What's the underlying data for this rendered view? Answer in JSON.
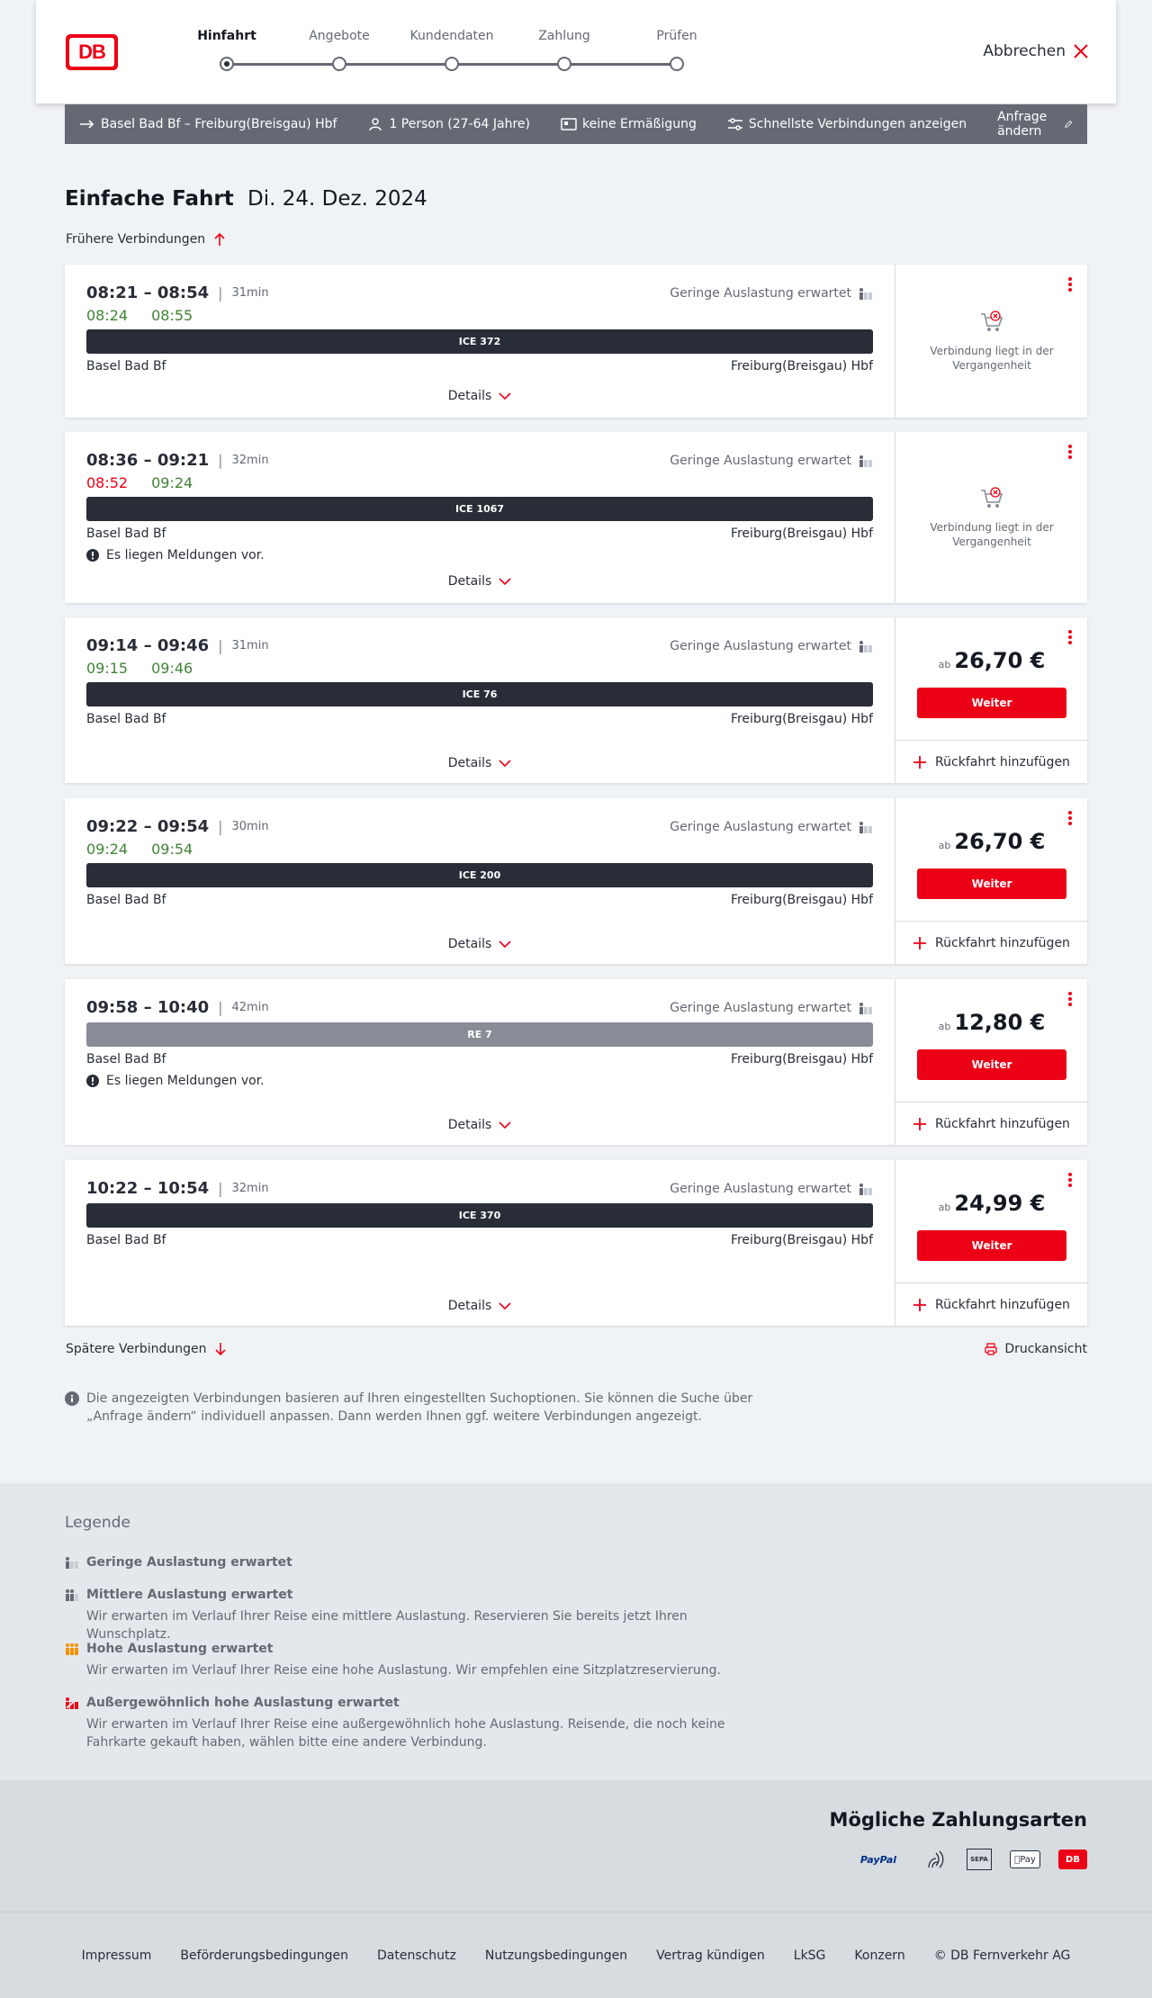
{
  "header": {
    "logo_text": "DB",
    "steps": [
      {
        "label": "Hinfahrt"
      },
      {
        "label": "Angebote"
      },
      {
        "label": "Kundendaten"
      },
      {
        "label": "Zahlung"
      },
      {
        "label": "Prüfen"
      }
    ],
    "active_step": 0,
    "cancel_label": "Abbrechen"
  },
  "searchbar": {
    "route": "Basel Bad Bf – Freiburg(Breisgau) Hbf",
    "travelers": "1 Person (27-64 Jahre)",
    "discount": "keine Ermäßigung",
    "fastest": "Schnellste Verbindungen anzeigen",
    "change": "Anfrage ändern"
  },
  "page": {
    "title_bold": "Einfache Fahrt",
    "title_date": "Di. 24. Dez. 2024",
    "earlier": "Frühere Verbindungen",
    "later": "Spätere Verbindungen",
    "print": "Druckansicht",
    "info": "Die angezeigten Verbindungen basieren auf Ihren eingestellten Suchoptionen. Sie können die Suche über „Anfrage ändern“ individuell anpassen. Dann werden Ihnen ggf. weitere Verbindungen angezeigt."
  },
  "common": {
    "load_low": "Geringe Auslastung erwartet",
    "details": "Details",
    "past": "Verbindung liegt in der Vergangenheit",
    "ab": "ab",
    "weiter": "Weiter",
    "return": "Rückfahrt hinzufügen",
    "notice": "Es liegen Meldungen vor."
  },
  "connections": [
    {
      "times": "08:21 – 08:54",
      "duration": "31min",
      "rt_dep": "08:24",
      "rt_arr": "08:55",
      "dep_late": false,
      "train": "ICE 372",
      "from": "Basel Bad Bf",
      "to": "Freiburg(Breisgau) Hbf",
      "past": true
    },
    {
      "times": "08:36 – 09:21",
      "duration": "32min",
      "rt_dep": "08:52",
      "rt_arr": "09:24",
      "dep_late": true,
      "train": "ICE 1067",
      "from": "Basel Bad Bf",
      "to": "Freiburg(Breisgau) Hbf",
      "past": true,
      "notice": true
    },
    {
      "times": "09:14 – 09:46",
      "duration": "31min",
      "rt_dep": "09:15",
      "rt_arr": "09:46",
      "train": "ICE 76",
      "from": "Basel Bad Bf",
      "to": "Freiburg(Breisgau) Hbf",
      "price": "26,70 €"
    },
    {
      "times": "09:22 – 09:54",
      "duration": "30min",
      "rt_dep": "09:24",
      "rt_arr": "09:54",
      "train": "ICE 200",
      "from": "Basel Bad Bf",
      "to": "Freiburg(Breisgau) Hbf",
      "price": "26,70 €"
    },
    {
      "times": "09:58 – 10:40",
      "duration": "42min",
      "train": "RE 7",
      "from": "Basel Bad Bf",
      "to": "Freiburg(Breisgau) Hbf",
      "price": "12,80 €",
      "notice": true
    },
    {
      "times": "10:22 – 10:54",
      "duration": "32min",
      "train": "ICE 370",
      "from": "Basel Bad Bf",
      "to": "Freiburg(Breisgau) Hbf",
      "price": "24,99 €"
    }
  ],
  "legend": {
    "title": "Legende",
    "items": [
      {
        "head": "Geringe Auslastung erwartet",
        "desc": ""
      },
      {
        "head": "Mittlere Auslastung erwartet",
        "desc": "Wir erwarten im Verlauf Ihrer Reise eine mittlere Auslastung. Reservieren Sie bereits jetzt Ihren Wunschplatz."
      },
      {
        "head": "Hohe Auslastung erwartet",
        "desc": "Wir erwarten im Verlauf Ihrer Reise eine hohe Auslastung. Wir empfehlen eine Sitzplatzreservierung."
      },
      {
        "head": "Außergewöhnlich hohe Auslastung erwartet",
        "desc": "Wir erwarten im Verlauf Ihrer Reise eine außergewöhnlich hohe Auslastung. Reisende, die noch keine Fahrkarte gekauft haben, wählen bitte eine andere Verbindung."
      }
    ]
  },
  "payment": {
    "title": "Mögliche Zahlungsarten",
    "paypal": "PayPal",
    "sepa": "SEPA",
    "apple": "Pay"
  },
  "footer": {
    "links": [
      "Impressum",
      "Beförderungsbedingungen",
      "Datenschutz",
      "Nutzungsbedingungen",
      "Vertrag kündigen",
      "LkSG",
      "Konzern",
      "© DB Fernverkehr AG"
    ]
  },
  "colors": {
    "accent": "#ec0016",
    "ontime": "#408335",
    "dark": "#282d37"
  }
}
